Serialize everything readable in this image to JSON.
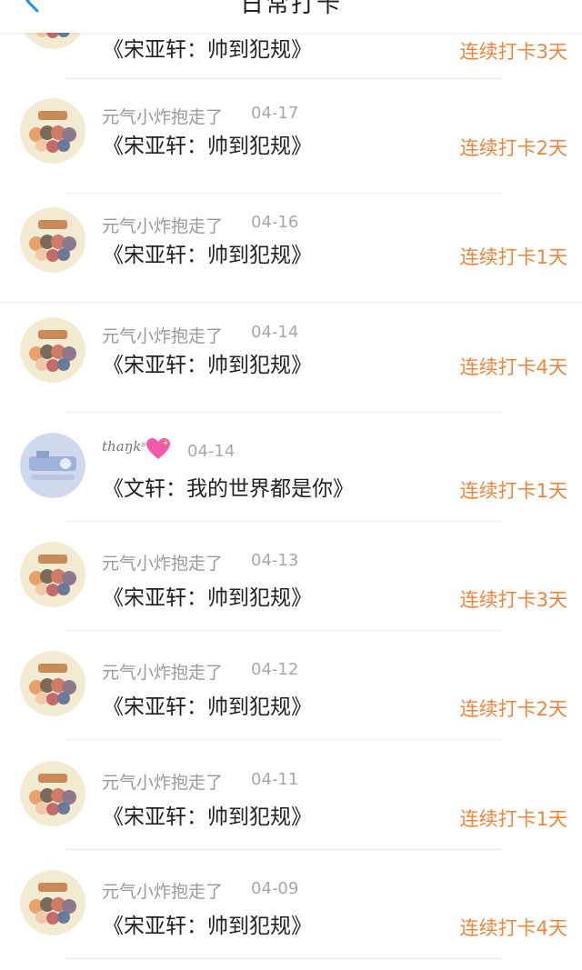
{
  "header": {
    "title": "日常打卡",
    "back_icon": "chevron-left-icon"
  },
  "colors": {
    "accent": "#1e8ff0",
    "streak": "#f0843a"
  },
  "checkins": [
    {
      "name": "",
      "date": "",
      "title": "《宋亚轩：帅到犯规》",
      "streak": "连续打卡3天",
      "avatar": "cartoon-group-avatar"
    },
    {
      "name": "元气小炸抱走了",
      "date": "04-17",
      "title": "《宋亚轩：帅到犯规》",
      "streak": "连续打卡2天",
      "avatar": "cartoon-group-avatar"
    },
    {
      "name": "元气小炸抱走了",
      "date": "04-16",
      "title": "《宋亚轩：帅到犯规》",
      "streak": "连续打卡1天",
      "avatar": "cartoon-group-avatar"
    },
    {
      "name": "元气小炸抱走了",
      "date": "04-14",
      "title": "《宋亚轩：帅到犯规》",
      "streak": "连续打卡4天",
      "avatar": "cartoon-group-avatar"
    },
    {
      "name": "thaŋkˢ",
      "date": "04-14",
      "title": "《文轩：我的世界都是你》",
      "streak": "连续打卡1天",
      "avatar": "blue-photo-avatar"
    },
    {
      "name": "元气小炸抱走了",
      "date": "04-13",
      "title": "《宋亚轩：帅到犯规》",
      "streak": "连续打卡3天",
      "avatar": "cartoon-group-avatar"
    },
    {
      "name": "元气小炸抱走了",
      "date": "04-12",
      "title": "《宋亚轩：帅到犯规》",
      "streak": "连续打卡2天",
      "avatar": "cartoon-group-avatar"
    },
    {
      "name": "元气小炸抱走了",
      "date": "04-11",
      "title": "《宋亚轩：帅到犯规》",
      "streak": "连续打卡1天",
      "avatar": "cartoon-group-avatar"
    },
    {
      "name": "元气小炸抱走了",
      "date": "04-09",
      "title": "《宋亚轩：帅到犯规》",
      "streak": "连续打卡4天",
      "avatar": "cartoon-group-avatar"
    }
  ]
}
